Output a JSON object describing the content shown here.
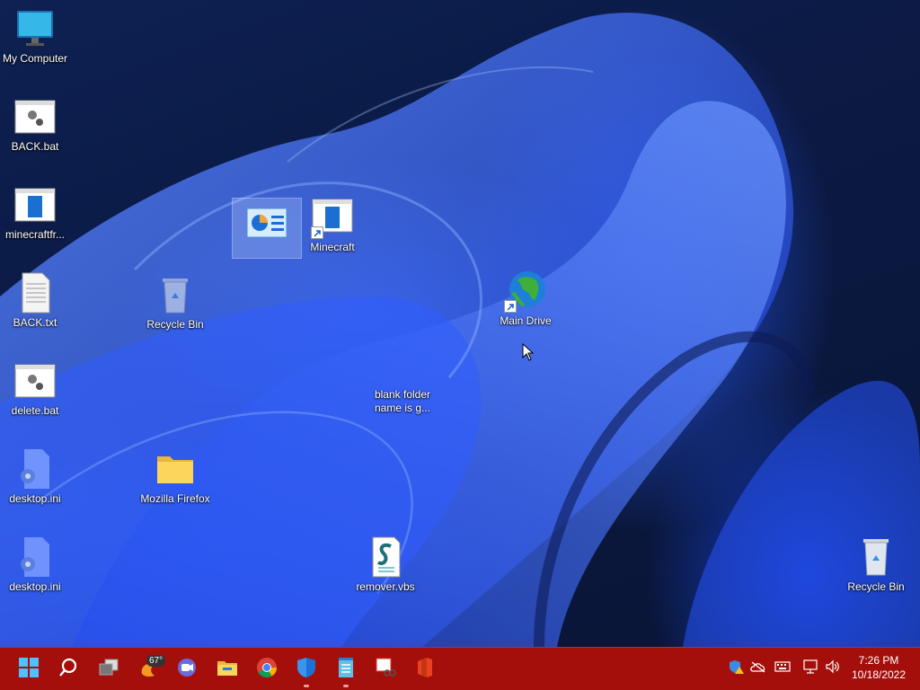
{
  "desktop": {
    "icons": [
      {
        "label": "My Computer",
        "icon": "monitor-icon"
      },
      {
        "label": "BACK.bat",
        "icon": "batch-file-icon"
      },
      {
        "label": "minecraftfr...",
        "icon": "app-window-icon"
      },
      {
        "label": "BACK.txt",
        "icon": "text-file-icon"
      },
      {
        "label": "delete.bat",
        "icon": "batch-file-icon"
      },
      {
        "label": "desktop.ini",
        "icon": "settings-file-icon"
      },
      {
        "label": "desktop.ini",
        "icon": "settings-file-icon"
      },
      {
        "label": "",
        "icon": "control-panel-icon"
      },
      {
        "label": "Minecraft",
        "icon": "app-shortcut-icon"
      },
      {
        "label": "Recycle Bin",
        "icon": "recycle-bin-icon"
      },
      {
        "label": "Main Drive",
        "icon": "globe-icon"
      },
      {
        "label": "blank folder name is g...",
        "icon": "blank-folder"
      },
      {
        "label": "Mozilla Firefox",
        "icon": "folder-icon"
      },
      {
        "label": "remover.vbs",
        "icon": "script-file-icon"
      },
      {
        "label": "Recycle Bin",
        "icon": "recycle-bin-icon"
      }
    ]
  },
  "taskbar": {
    "weather_temp": "67°",
    "apps": [
      "start-icon",
      "search-icon",
      "task-view-icon",
      "weather-icon",
      "chat-icon",
      "file-explorer-icon",
      "chrome-icon",
      "defender-icon",
      "notepad-icon",
      "snipping-tool-icon",
      "office-icon"
    ],
    "tray": [
      "security-warning-icon",
      "onedrive-icon",
      "keyboard-icon",
      "network-icon",
      "volume-icon"
    ],
    "clock": {
      "time": "7:26 PM",
      "date": "10/18/2022"
    }
  },
  "colors": {
    "taskbar": "#a50f0b",
    "wallpaper_accent": "#2f5cff"
  }
}
